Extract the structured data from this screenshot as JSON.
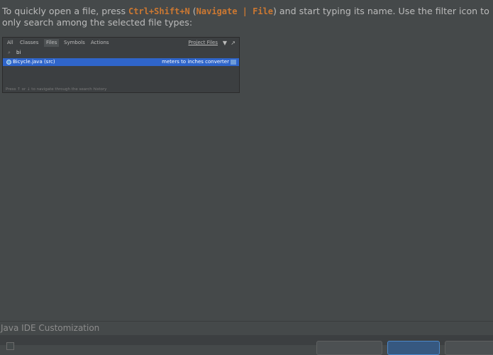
{
  "tip": {
    "part1": "To quickly open a file, press ",
    "shortcut": "Ctrl+Shift+N",
    "part2": " (",
    "menu_path": "Navigate | File",
    "part3": ") and start typing its name. Use the filter icon to only search among the selected file types:"
  },
  "screenshot": {
    "tabs": [
      "All",
      "Classes",
      "Files",
      "Symbols",
      "Actions"
    ],
    "active_tab": "Files",
    "scope": "Project Files",
    "search_value": "bi",
    "result_name": "Bicycle.java (src)",
    "result_path": "meters to inches converter",
    "footer_hint": "Press ↑ or ↓ to navigate through the search history"
  },
  "section_label": "Java IDE Customization",
  "colors": {
    "background": "#45494a",
    "shortcut": "#cc7832",
    "selection": "#2f65ca"
  }
}
